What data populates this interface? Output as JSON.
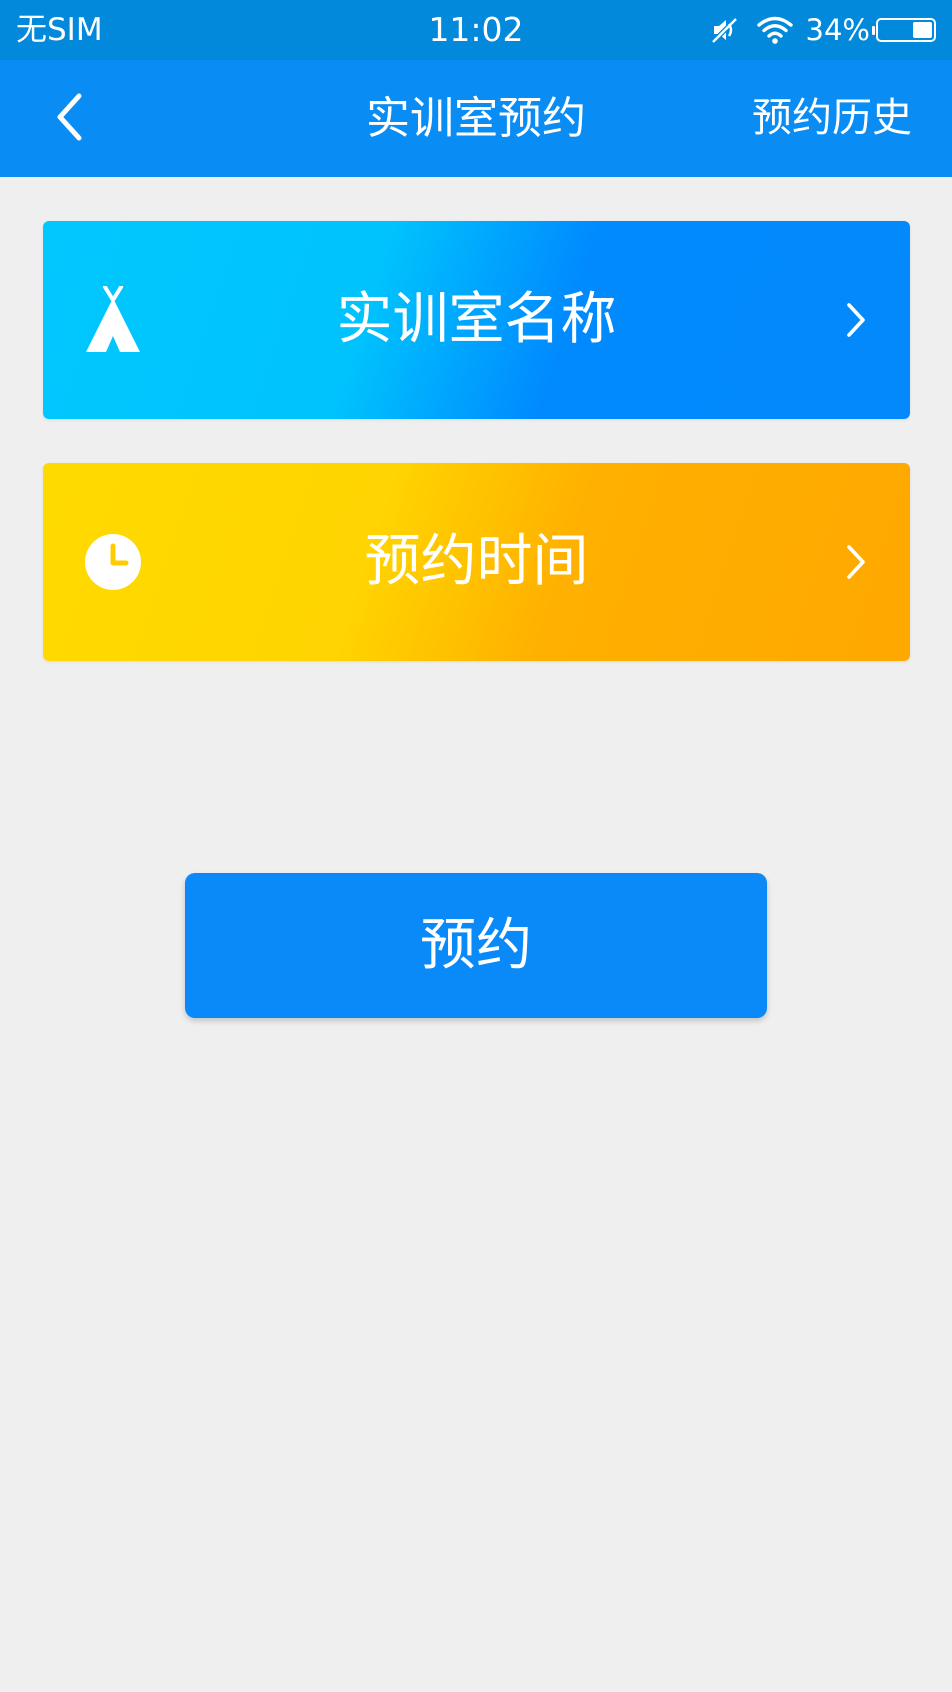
{
  "status_bar": {
    "carrier": "无SIM",
    "time": "11:02",
    "battery_text": "34%",
    "battery_level": 0.34,
    "icons": [
      "mute-icon",
      "wifi-icon",
      "battery-icon"
    ]
  },
  "nav": {
    "back_icon": "chevron-left-icon",
    "title": "实训室预约",
    "history_label": "预约历史"
  },
  "cards": {
    "room": {
      "label": "实训室名称",
      "icon": "tent-icon",
      "chevron": "chevron-right-icon"
    },
    "time": {
      "label": "预约时间",
      "icon": "clock-icon",
      "chevron": "chevron-right-icon"
    }
  },
  "reserve_button": {
    "label": "预约"
  },
  "colors": {
    "status_bar": "#0389dc",
    "nav_bar": "#0a8cf5",
    "room_card_start": "#00c8ff",
    "room_card_end": "#0389fb",
    "time_card_start": "#ffda00",
    "time_card_end": "#ffa800",
    "button": "#0a8af8",
    "background": "#efeff0"
  }
}
